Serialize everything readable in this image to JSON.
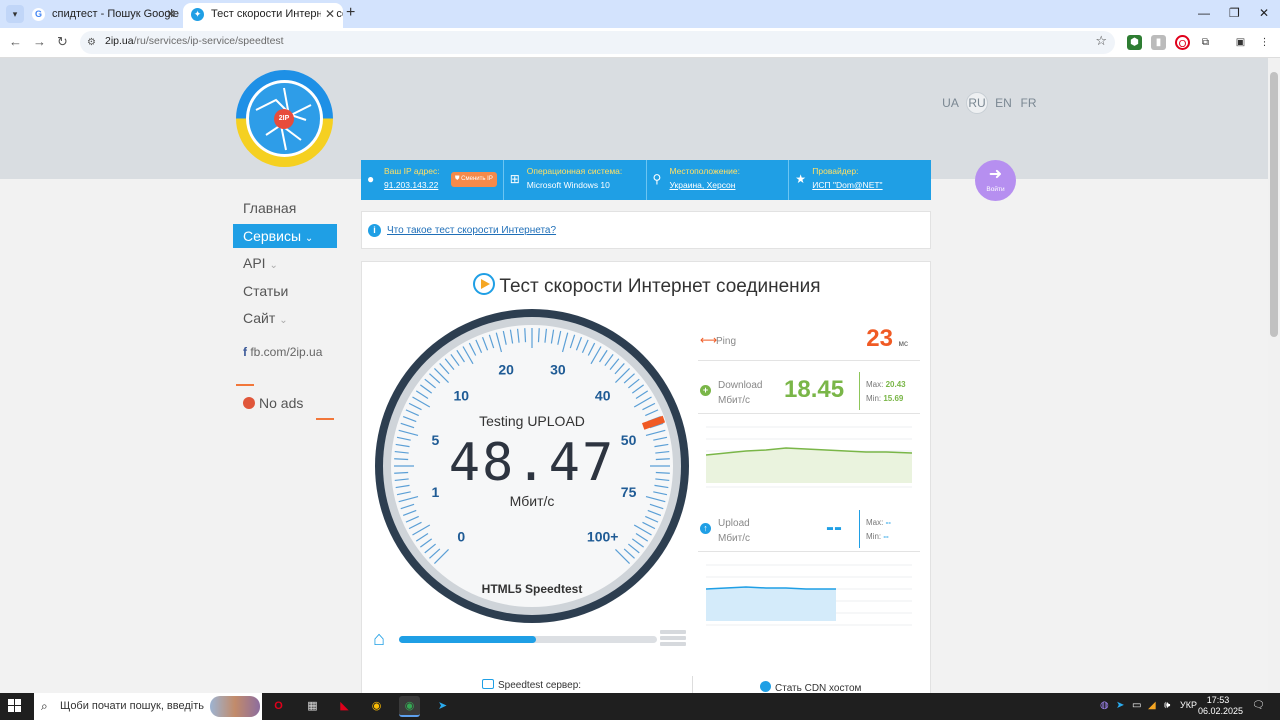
{
  "browser": {
    "tabs": [
      {
        "title": "спидтест - Пошук Google",
        "favicon": "google-g-icon"
      },
      {
        "title": "Тест скорости Интернет соедин",
        "favicon": "2ip-icon",
        "active": true
      }
    ],
    "url_host": "2ip.ua",
    "url_path": "/ru/services/ip-service/speedtest"
  },
  "site": {
    "logo_badge": "2IP",
    "langs": [
      "UA",
      "RU",
      "EN",
      "FR"
    ],
    "active_lang": "RU",
    "login_label": "Войти",
    "infobar": [
      {
        "label": "Ваш IP адрес:",
        "value": "91.203.143.22",
        "chip": "Сменить IP",
        "icon": "globe-icon"
      },
      {
        "label": "Операционная система:",
        "value": "Microsoft Windows 10",
        "icon": "windows-icon"
      },
      {
        "label": "Местоположение:",
        "value": "Украина, Херсон",
        "icon": "location-pin-icon"
      },
      {
        "label": "Провайдер:",
        "value": "ИСП \"Dom@NET\"",
        "icon": "star-icon"
      }
    ],
    "menu": [
      {
        "label": "Главная"
      },
      {
        "label": "Сервисы",
        "active": true,
        "chevron": true
      },
      {
        "label": "API",
        "chevron": true
      },
      {
        "label": "Статьи"
      },
      {
        "label": "Сайт",
        "chevron": true
      }
    ],
    "fb_link": "fb.com/2ip.ua",
    "no_ads": "No ads",
    "what_is": "Что такое тест скорости Интернета?",
    "title": "Тест скорости Интернет соединения",
    "gauge": {
      "status": "Testing UPLOAD",
      "value": "48.47",
      "unit": "Мбит/с",
      "footer": "HTML5 Speedtest",
      "ticks": [
        "0",
        "1",
        "5",
        "10",
        "20",
        "30",
        "40",
        "50",
        "75",
        "100+"
      ]
    },
    "progress": 0.53,
    "ping": {
      "label": "Ping",
      "value": "23",
      "unit": "мс"
    },
    "download": {
      "label": "Download",
      "unit": "Мбит/с",
      "value": "18.45",
      "max_label": "Max:",
      "max": "20.43",
      "min_label": "Min:",
      "min": "15.69"
    },
    "upload": {
      "label": "Upload",
      "unit": "Мбит/с",
      "value": "--",
      "max_label": "Max:",
      "max": "--",
      "min_label": "Min:",
      "min": "--"
    },
    "server_label": "Speedtest сервер:",
    "cdn_label": "Стать CDN хостом"
  },
  "taskbar": {
    "search_placeholder": "Щоби почати пошук, введіть",
    "lang": "УКР",
    "time": "17:53",
    "date": "06.02.2025"
  },
  "colors": {
    "accent": "#1f9fe5",
    "ping": "#f05a24",
    "download": "#7ab648",
    "upload": "#1f9fe5"
  }
}
